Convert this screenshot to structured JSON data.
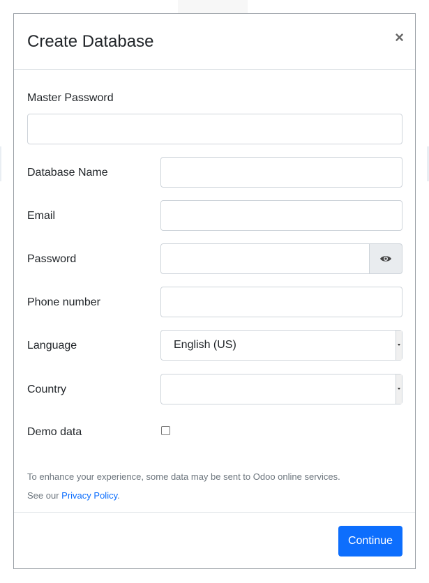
{
  "dialog": {
    "title": "Create Database",
    "close_label": "×"
  },
  "form": {
    "master_password": {
      "label": "Master Password",
      "value": ""
    },
    "database_name": {
      "label": "Database Name",
      "value": ""
    },
    "email": {
      "label": "Email",
      "value": ""
    },
    "password": {
      "label": "Password",
      "value": "",
      "toggle_icon": "eye-icon"
    },
    "phone": {
      "label": "Phone number",
      "value": ""
    },
    "language": {
      "label": "Language",
      "selected": "English (US)"
    },
    "country": {
      "label": "Country",
      "selected": ""
    },
    "demo_data": {
      "label": "Demo data",
      "checked": false
    }
  },
  "notice": {
    "line1": "To enhance your experience, some data may be sent to Odoo online services.",
    "see_our": "See our",
    "link_label": "Privacy Policy",
    "suffix": "."
  },
  "footer": {
    "continue_label": "Continue"
  },
  "colors": {
    "primary": "#0d6efd",
    "border": "#ced4da",
    "muted_text": "#6c757d"
  }
}
